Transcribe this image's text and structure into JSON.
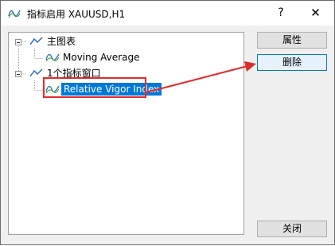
{
  "window": {
    "title": "指标启用 XAUUSD,H1",
    "icon": "indicator-wave-icon",
    "help_label": "?",
    "close_label": "✕"
  },
  "tree": {
    "root_main": {
      "label": "主图表",
      "icon": "chart-line-icon"
    },
    "main_child": {
      "label": "Moving Average",
      "icon": "indicator-wave-icon"
    },
    "root_window": {
      "label": "1个指标窗口",
      "icon": "chart-line-icon"
    },
    "window_child": {
      "label": "Relative Vigor Index",
      "icon": "indicator-wave-icon",
      "selected": true
    }
  },
  "buttons": {
    "properties": "属性",
    "delete": "删除",
    "close": "关闭"
  },
  "annotation": {
    "color": "#e02b2b"
  }
}
